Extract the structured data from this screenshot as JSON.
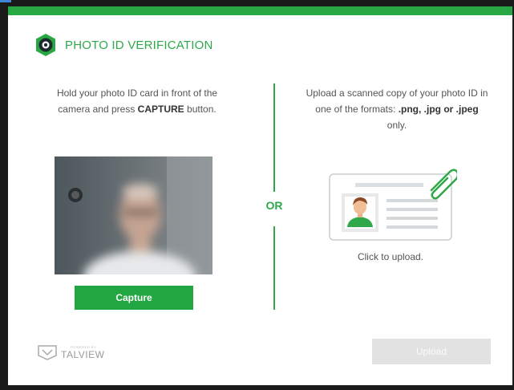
{
  "header": {
    "title": "PHOTO ID VERIFICATION",
    "icon": "camera-badge-icon"
  },
  "capture_panel": {
    "instruction_pre": "Hold your photo ID card in front of the camera and press ",
    "instruction_bold": "CAPTURE",
    "instruction_post": " button.",
    "button_label": "Capture"
  },
  "separator": {
    "label": "OR"
  },
  "upload_panel": {
    "instruction_pre": "Upload a scanned copy of your photo ID in one of the formats: ",
    "formats_bold": ".png, .jpg or .jpeg",
    "instruction_post": " only.",
    "click_label": "Click to upload.",
    "button_label": "Upload"
  },
  "footer": {
    "brand_powered": "POWERED BY",
    "brand_name": "TALVIEW"
  },
  "colors": {
    "accent": "#22a641",
    "disabled": "#e2e2e2"
  }
}
